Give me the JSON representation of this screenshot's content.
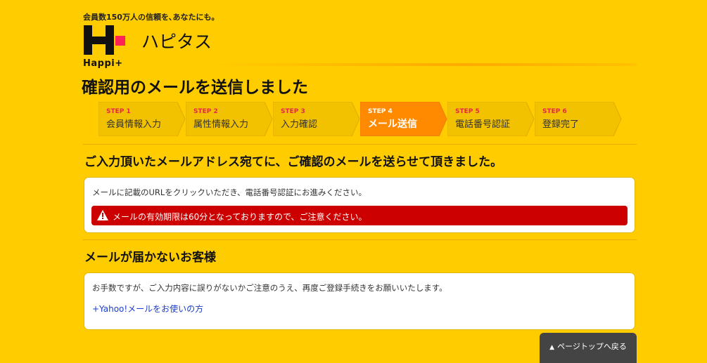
{
  "header": {
    "tagline": "会員数150万人の信頼を､あなたにも｡",
    "logo_text": "Happi+",
    "brand_name": "ハピタス"
  },
  "page_title": "確認用のメールを送信しました",
  "steps": [
    {
      "num": "STEP 1",
      "label": "会員情報入力",
      "active": false
    },
    {
      "num": "STEP 2",
      "label": "属性情報入力",
      "active": false
    },
    {
      "num": "STEP 3",
      "label": "入力確認",
      "active": false
    },
    {
      "num": "STEP 4",
      "label": "メール送信",
      "active": true
    },
    {
      "num": "STEP 5",
      "label": "電話番号認証",
      "active": false
    },
    {
      "num": "STEP 6",
      "label": "登録完了",
      "active": false
    }
  ],
  "section1": {
    "heading": "ご入力頂いたメールアドレス宛てに、ご確認のメールを送らせて頂きました。",
    "text": "メールに記載のURLをクリックいただき、電話番号認証にお進みください。",
    "alert": "メールの有効期限は60分となっておりますので、ご注意ください。"
  },
  "section2": {
    "heading": "メールが届かないお客様",
    "text": "お手数ですが、ご入力内容に誤りがないかご注意のうえ、再度ご登録手続きをお願いいたします。",
    "link": "+Yahoo!メールをお使いの方"
  },
  "pagetop": {
    "icon": "▲",
    "label": "ページトップへ戻る"
  },
  "colors": {
    "background": "#ffcc00",
    "step_inactive": "#f2c200",
    "step_active": "#ff8a00",
    "step_number": "#e8264a",
    "alert": "#cc0000",
    "logo_accent": "#ff2255"
  }
}
